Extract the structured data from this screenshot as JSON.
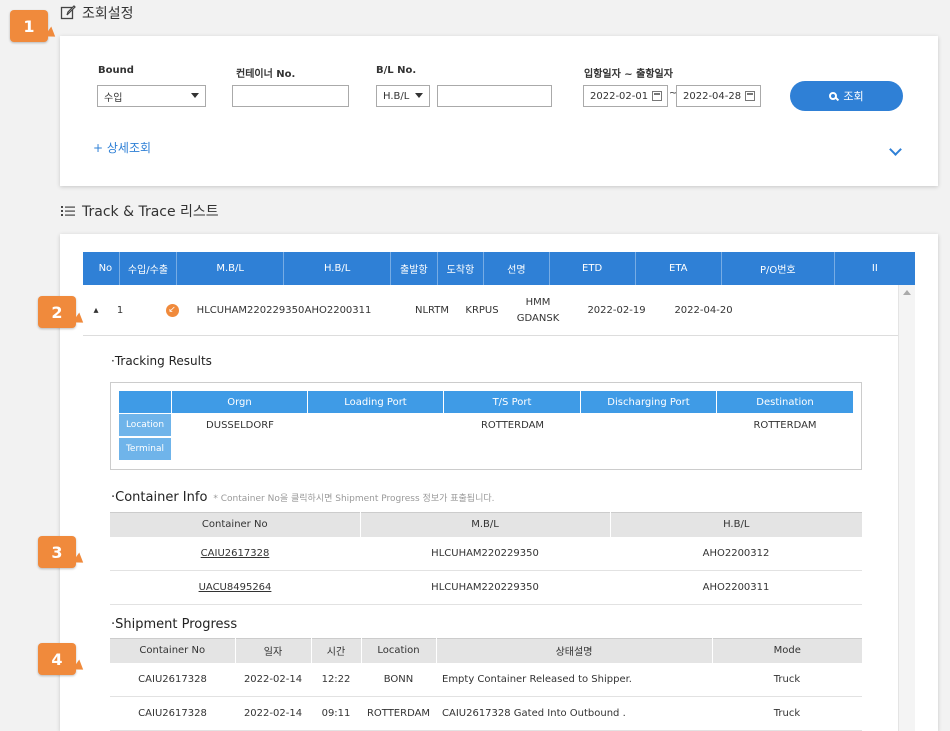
{
  "callouts": [
    "1",
    "2",
    "3",
    "4"
  ],
  "search_section": {
    "title": "조회설정",
    "icon": "edit-icon"
  },
  "filters": {
    "bound": {
      "label": "Bound",
      "value": "수입"
    },
    "container": {
      "label": "컨테이너 No.",
      "value": ""
    },
    "bl": {
      "label": "B/L No.",
      "type_value": "H.B/L",
      "value": ""
    },
    "dates": {
      "label": "입항일자 ~ 출항일자",
      "from": "2022-02-01",
      "separator": "~",
      "to": "2022-04-28"
    },
    "search_button": "조회",
    "advanced": "+ 상세조회"
  },
  "list_section": {
    "title": "Track & Trace 리스트",
    "icon": "list-icon"
  },
  "main_table": {
    "headers": [
      "No",
      "수입/수출",
      "M.B/L",
      "H.B/L",
      "출발항",
      "도착항",
      "선명",
      "ETD",
      "ETA",
      "P/O번호",
      "II"
    ],
    "row": {
      "no": "1",
      "mbl": "HLCUHAM220229350",
      "hbl": "AHO2200311",
      "departure": "NLRTM",
      "arrival": "KRPUS",
      "vessel_line1": "HMM",
      "vessel_line2": "GDANSK",
      "etd": "2022-02-19",
      "eta": "2022-04-20",
      "po": ""
    }
  },
  "tracking": {
    "title": "·Tracking Results",
    "headers": [
      "Orgn",
      "Loading Port",
      "T/S Port",
      "Discharging Port",
      "Destination"
    ],
    "row_labels": [
      "Location",
      "Terminal"
    ],
    "location": [
      "DUSSELDORF",
      "",
      "ROTTERDAM",
      "",
      "ROTTERDAM"
    ]
  },
  "container_info": {
    "title": "·Container Info",
    "note": "* Container No을 클릭하시면 Shipment Progress 정보가 표출됩니다.",
    "headers": [
      "Container No",
      "M.B/L",
      "H.B/L"
    ],
    "rows": [
      [
        "CAIU2617328",
        "HLCUHAM220229350",
        "AHO2200312"
      ],
      [
        "UACU8495264",
        "HLCUHAM220229350",
        "AHO2200311"
      ]
    ]
  },
  "shipment": {
    "title": "·Shipment Progress",
    "headers": [
      "Container No",
      "일자",
      "시간",
      "Location",
      "상태설명",
      "Mode"
    ],
    "rows": [
      [
        "CAIU2617328",
        "2022-02-14",
        "12:22",
        "BONN",
        "Empty Container Released to Shipper.",
        "Truck"
      ],
      [
        "CAIU2617328",
        "2022-02-14",
        "09:11",
        "ROTTERDAM",
        "CAIU2617328 Gated Into Outbound .",
        "Truck"
      ]
    ]
  },
  "colors": {
    "accent": "#2f80d6",
    "callout": "#f08a3c",
    "import_badge": "#f08a3c"
  }
}
